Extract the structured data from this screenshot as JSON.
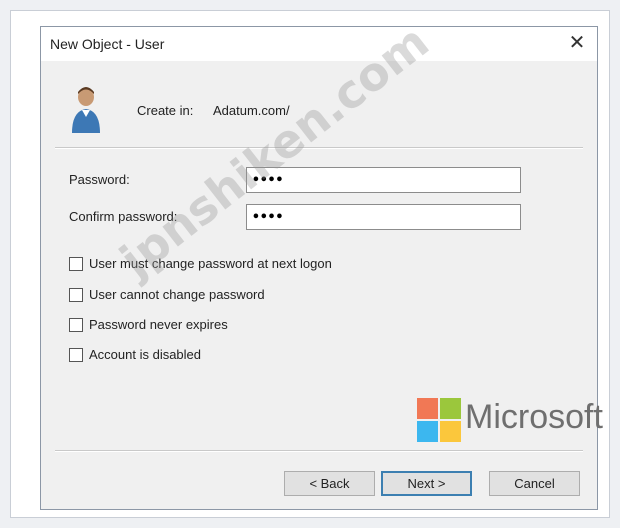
{
  "window": {
    "title": "New Object - User",
    "close_glyph": "✕"
  },
  "create_in": {
    "label": "Create in:",
    "value": "Adatum.com/"
  },
  "form": {
    "password_label": "Password:",
    "password_value": "••••",
    "confirm_label": "Confirm password:",
    "confirm_value": "••••"
  },
  "options": [
    {
      "label": "User must change password at next logon",
      "checked": false
    },
    {
      "label": "User cannot change password",
      "checked": false
    },
    {
      "label": "Password never expires",
      "checked": false
    },
    {
      "label": "Account is disabled",
      "checked": false
    }
  ],
  "buttons": {
    "back": "< Back",
    "next": "Next >",
    "cancel": "Cancel"
  },
  "overlay": {
    "watermark": "jpnshiken.com",
    "brand_text": "Microsoft",
    "brand_colors": [
      "#f25022",
      "#7fba00",
      "#00a4ef",
      "#ffb900"
    ]
  },
  "icons": {
    "user": "user-icon",
    "close": "close-icon"
  }
}
